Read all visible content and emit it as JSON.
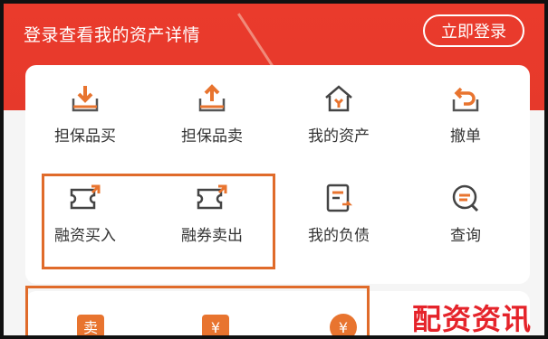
{
  "header": {
    "title": "登录查看我的资产详情",
    "login_button": "立即登录"
  },
  "grid": {
    "row1": [
      "担保品买",
      "担保品卖",
      "我的资产",
      "撤单"
    ],
    "row2": [
      "融资买入",
      "融券卖出",
      "我的负债",
      "查询"
    ]
  },
  "bottom_icons": [
    "卖",
    "¥",
    "¥"
  ],
  "watermark": "配资资讯",
  "colors": {
    "header_red": "#e6392b",
    "icon_orange": "#e8742f",
    "highlight_orange": "#e06b2a",
    "watermark_red": "#e5232a"
  }
}
